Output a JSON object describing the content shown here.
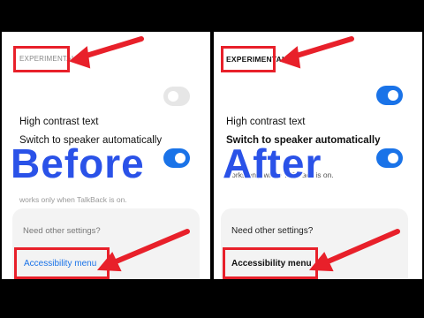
{
  "before": {
    "section_label": "EXPERIMENTAL",
    "setting1_title": "High contrast text",
    "setting1_state": "off",
    "setting2_title": "Switch to speaker automatically",
    "setting2_desc_line": "works only when TalkBack is on.",
    "setting2_state": "on",
    "card_heading": "Need other settings?",
    "card_link": "Accessibility menu",
    "overlay": "Before"
  },
  "after": {
    "section_label": "EXPERIMENTAL",
    "setting1_title": "High contrast text",
    "setting1_state": "on",
    "setting2_title": "Switch to speaker automatically",
    "setting2_desc_line": "works only when TalkBack is on.",
    "setting2_state": "on",
    "card_heading": "Need other settings?",
    "card_link": "Accessibility menu",
    "overlay": "After"
  },
  "colors": {
    "annotation_red": "#e8202a",
    "toggle_on": "#1a73e8",
    "overlay_text": "#2a52e8"
  }
}
